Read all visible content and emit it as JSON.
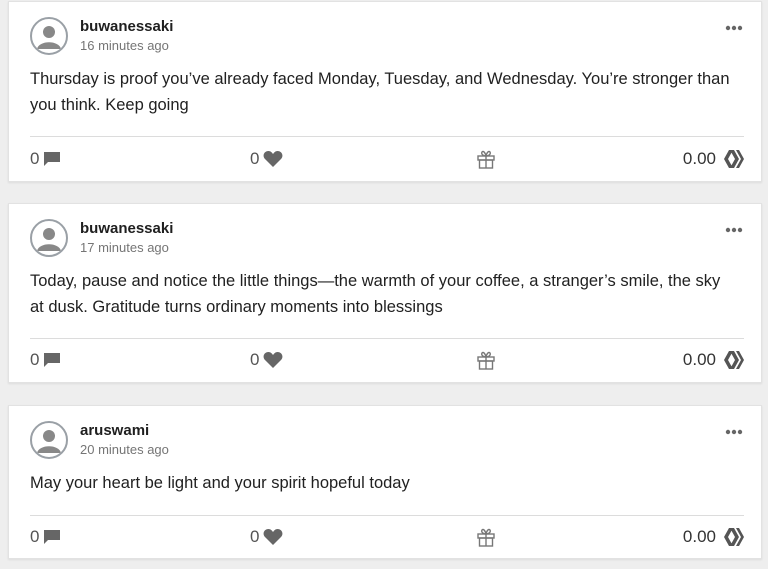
{
  "posts": [
    {
      "username": "buwanessaki",
      "time": "16 minutes ago",
      "body": "Thursday is proof you’ve already faced Monday, Tuesday, and Wednesday. You’re stronger than you think. Keep going",
      "comments": "0",
      "likes": "0",
      "payout": "0.00"
    },
    {
      "username": "buwanessaki",
      "time": "17 minutes ago",
      "body": "Today, pause and notice the little things—the warmth of your coffee, a stranger’s smile, the sky at dusk. Gratitude turns ordinary moments into blessings",
      "comments": "0",
      "likes": "0",
      "payout": "0.00"
    },
    {
      "username": "aruswami",
      "time": "20 minutes ago",
      "body": "May your heart be light and your spirit hopeful today",
      "comments": "0",
      "likes": "0",
      "payout": "0.00"
    }
  ],
  "icons": {
    "avatar": "user-avatar-icon",
    "more": "more-options-icon",
    "comment": "comment-icon",
    "like": "heart-icon",
    "gift": "gift-icon",
    "payout": "hive-logo-icon"
  },
  "colors": {
    "background": "#eeeeee",
    "card": "#ffffff",
    "icon": "#666666",
    "muted": "#757575"
  }
}
